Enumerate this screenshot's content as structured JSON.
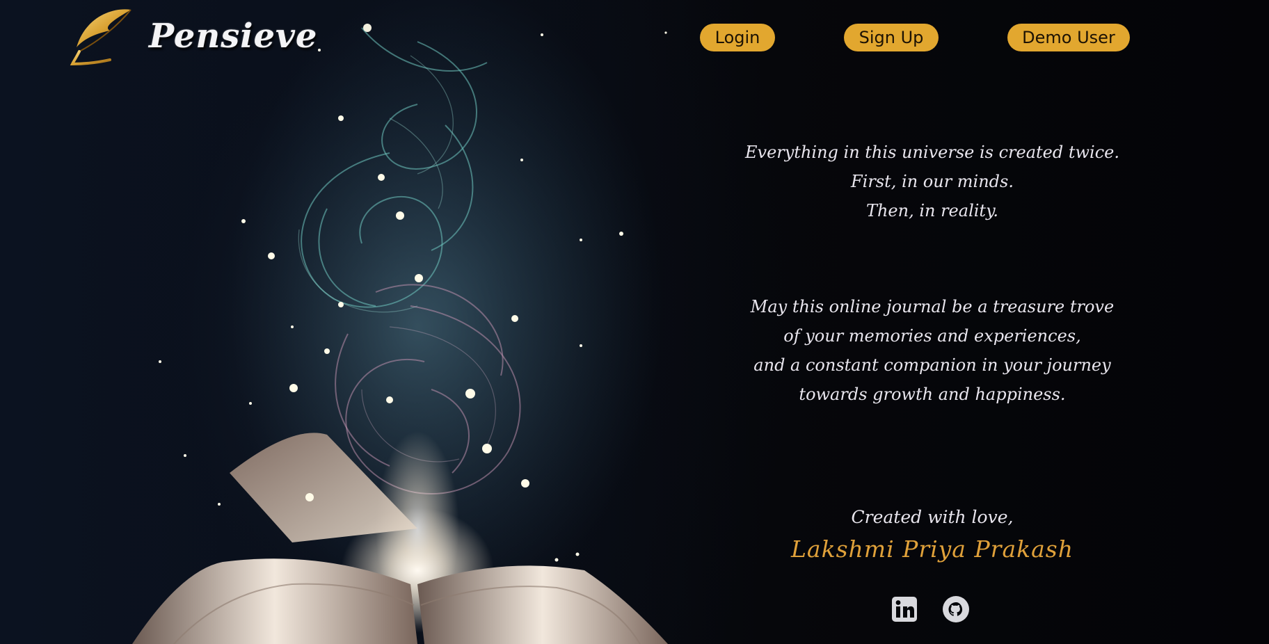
{
  "header": {
    "brand_name": "Pensieve",
    "logo_icon": "golden-quill-icon",
    "nav": {
      "login_label": "Login",
      "signup_label": "Sign Up",
      "demo_label": "Demo User"
    }
  },
  "quote_primary": {
    "lines": [
      "Everything in this universe is created twice.",
      "First, in our minds.",
      "Then, in reality."
    ]
  },
  "quote_secondary": {
    "lines": [
      "May this online journal be a treasure trove",
      "of your memories and experiences,",
      "and a constant companion in your journey",
      "towards growth and happiness."
    ]
  },
  "credit": {
    "label": "Created with love,",
    "author": "Lakshmi Priya Prakash"
  },
  "social": {
    "linkedin_icon": "linkedin-icon",
    "github_icon": "github-icon"
  },
  "colors": {
    "accent": "#e2a72f",
    "author": "#e0a13a",
    "text": "#e9e6ee",
    "background": "#05060a"
  }
}
